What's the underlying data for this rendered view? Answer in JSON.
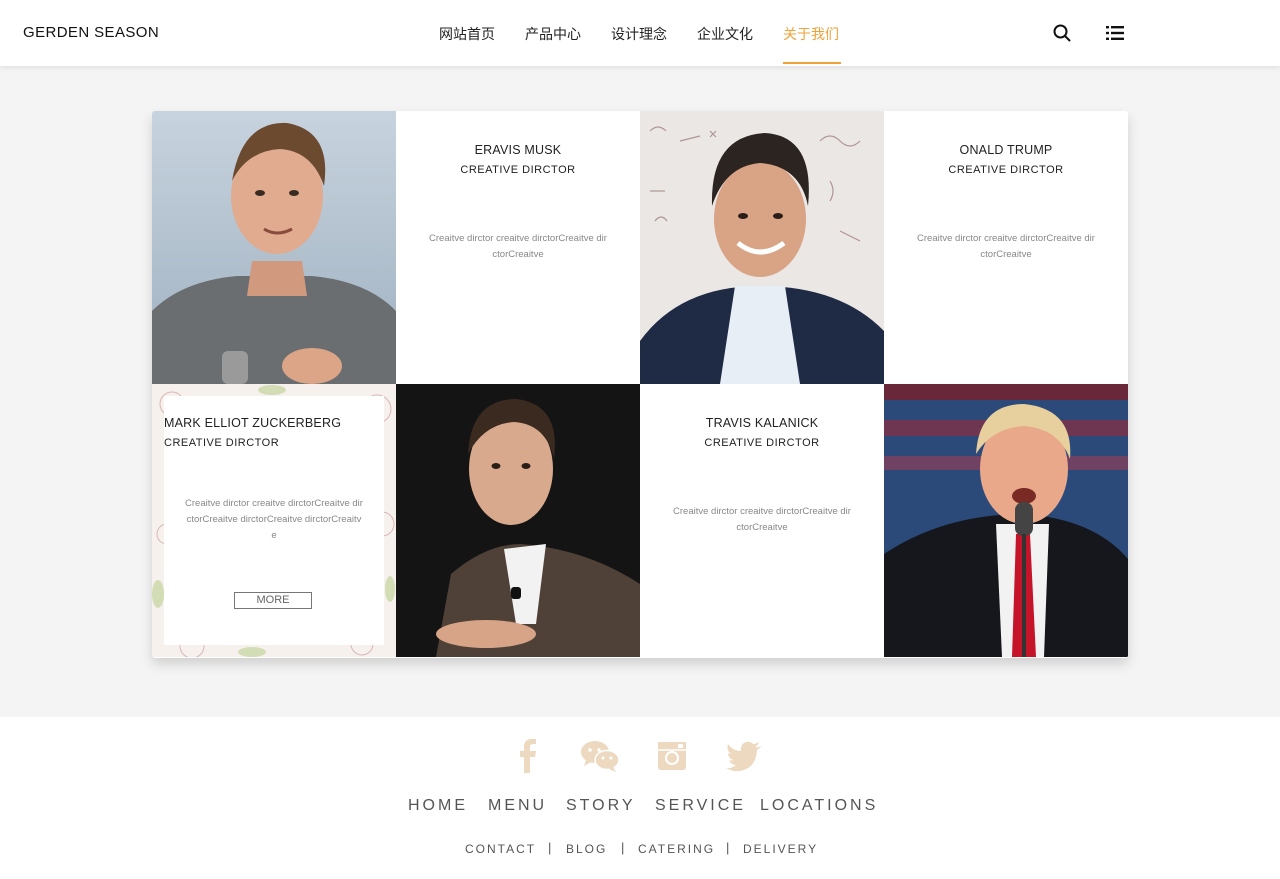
{
  "brand": {
    "name": "GERDEN SEASON"
  },
  "nav": {
    "items": [
      {
        "label": "网站首页"
      },
      {
        "label": "产品中心"
      },
      {
        "label": "设计理念"
      },
      {
        "label": "企业文化"
      },
      {
        "label": "关于我们"
      }
    ],
    "active_index": 4,
    "accent_color": "#f0a23a"
  },
  "header_icons": [
    "search-icon",
    "list-menu-icon"
  ],
  "team": [
    {
      "name": "ERAVIS MUSK",
      "role": "CREATIVE DIRCTOR",
      "desc": "Creaitve dirctor creaitve dirctorCreaitve dirctorCreaitve"
    },
    {
      "name": "ONALD TRUMP",
      "role": "CREATIVE DIRCTOR",
      "desc": "Creaitve dirctor creaitve dirctorCreaitve dirctorCreaitve"
    },
    {
      "name": "MARK ELLIOT ZUCKERBERG",
      "role": "CREATIVE DIRCTOR",
      "desc": "Creaitve dirctor creaitve dirctorCreaitve dirctorCreaitve dirctorCreaitve dirctorCreaitve",
      "more_label": "MORE"
    },
    {
      "name": "TRAVIS KALANICK",
      "role": "CREATIVE DIRCTOR",
      "desc": "Creaitve dirctor creaitve dirctorCreaitve dirctorCreaitve"
    }
  ],
  "footer": {
    "social_icons": [
      "facebook-icon",
      "wechat-icon",
      "instagram-icon",
      "twitter-icon"
    ],
    "social_color": "#ecd9bf",
    "main_links": [
      "HOME",
      "MENU",
      "STORY",
      "SERVICE",
      "LOCATIONS"
    ],
    "sub_links": [
      "CONTACT",
      "BLOG",
      "CATERING",
      "DELIVERY"
    ],
    "separator": "|"
  }
}
